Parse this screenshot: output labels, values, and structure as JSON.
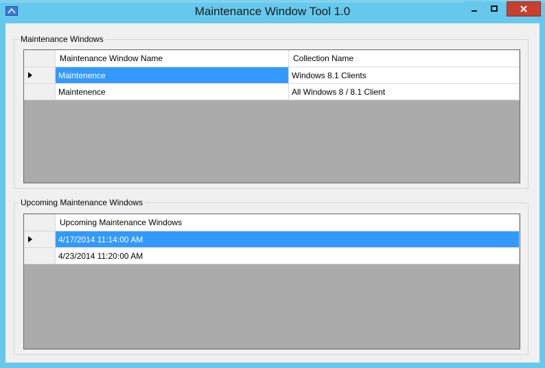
{
  "window": {
    "title": "Maintenance Window Tool 1.0",
    "icons": {
      "app": "app-icon",
      "minimize": "minimize-icon",
      "maximize": "maximize-icon",
      "close": "close-icon"
    }
  },
  "maintenance_group": {
    "label": "Maintenance Windows",
    "columns": [
      "Maintenance Window Name",
      "Collection Name"
    ],
    "rows": [
      {
        "selected": true,
        "name": "Maintenence",
        "collection": "Windows 8.1 Clients"
      },
      {
        "selected": false,
        "name": "Maintenence",
        "collection": "All Windows 8 / 8.1 Client"
      }
    ]
  },
  "upcoming_group": {
    "label": "Upcoming Maintenance Windows",
    "columns": [
      "Upcoming Maintenance Windows"
    ],
    "rows": [
      {
        "selected": true,
        "value": "4/17/2014 11:14:00 AM"
      },
      {
        "selected": false,
        "value": "4/23/2014 11:20:00 AM"
      }
    ]
  },
  "colors": {
    "frame": "#66c8ec",
    "selection": "#3399ff",
    "close_button": "#c7402e",
    "grid_empty": "#ababab"
  }
}
